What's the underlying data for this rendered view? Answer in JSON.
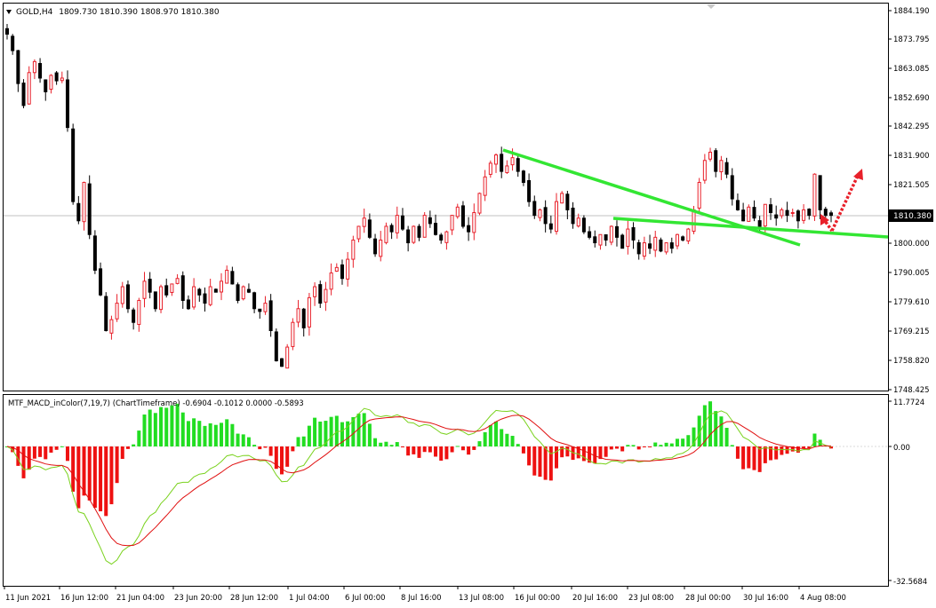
{
  "header": {
    "symbol": "GOLD,H4",
    "ohlc": "1809.730 1810.390 1808.970 1810.380"
  },
  "indicator": {
    "label": "MTF_MACD_inColor(7,19,7) (ChartTimeframe) -0.6904 -0.1012 0.0000 -0.5893"
  },
  "colors": {
    "bull_candle": "#e8202a",
    "bear_candle": "#000000",
    "trendline": "#33e633",
    "arrow": "#e8202a",
    "hist_pos": "#22dd22",
    "hist_neg": "#ee1111",
    "macd_line": "#7ad21e",
    "signal_line": "#e01010",
    "price_line": "#c0c0c0"
  },
  "chart_data": [
    {
      "type": "candlestick",
      "symbol": "GOLD",
      "timeframe": "H4",
      "y_ticks": [
        "1884.190",
        "1873.795",
        "1863.085",
        "1852.690",
        "1842.295",
        "1831.900",
        "1821.505",
        "1810.380",
        "1800.000",
        "1790.005",
        "1779.610",
        "1769.215",
        "1758.820",
        "1748.425"
      ],
      "current_price": "1810.380",
      "ylim": [
        1746.5,
        1886.5
      ],
      "x_ticks": [
        "11 Jun 2021",
        "16 Jun 12:00",
        "21 Jun 04:00",
        "23 Jun 20:00",
        "28 Jun 12:00",
        "1 Jul 04:00",
        "6 Jul 00:00",
        "8 Jul 16:00",
        "13 Jul 08:00",
        "16 Jul 00:00",
        "20 Jul 16:00",
        "23 Jul 08:00",
        "28 Jul 00:00",
        "30 Jul 16:00",
        "4 Aug 08:00"
      ],
      "close_path": [
        1876,
        1870,
        1858,
        1850,
        1862,
        1866,
        1860,
        1855,
        1861,
        1859,
        1860,
        1842,
        1815,
        1808,
        1822,
        1803,
        1790,
        1781,
        1768,
        1772,
        1778,
        1784,
        1776,
        1771,
        1779,
        1786,
        1782,
        1776,
        1784,
        1781,
        1785,
        1787,
        1779,
        1776,
        1784,
        1781,
        1778,
        1784,
        1782,
        1786,
        1790,
        1785,
        1779,
        1784,
        1782,
        1776,
        1775,
        1778,
        1768,
        1757,
        1755,
        1762,
        1771,
        1776,
        1769,
        1780,
        1784,
        1778,
        1783,
        1789,
        1791,
        1787,
        1794,
        1801,
        1806,
        1809,
        1802,
        1796,
        1801,
        1806,
        1804,
        1810,
        1805,
        1800,
        1806,
        1802,
        1810,
        1807,
        1803,
        1801,
        1804,
        1810,
        1813,
        1806,
        1804,
        1811,
        1818,
        1824,
        1829,
        1832,
        1826,
        1828,
        1831,
        1826,
        1822,
        1815,
        1810,
        1812,
        1807,
        1805,
        1815,
        1818,
        1812,
        1807,
        1809,
        1804,
        1802,
        1800,
        1803,
        1801,
        1806,
        1802,
        1798,
        1805,
        1801,
        1796,
        1800,
        1798,
        1802,
        1797,
        1800,
        1798,
        1803,
        1801,
        1805,
        1812,
        1822,
        1830,
        1833,
        1826,
        1830,
        1825,
        1816,
        1812,
        1808,
        1813,
        1809,
        1806,
        1814,
        1811,
        1809,
        1812,
        1810,
        1811,
        1808,
        1812,
        1810,
        1825,
        1812,
        1810,
        1810
      ]
    },
    {
      "type": "bar",
      "name": "MTF_MACD_inColor(7,19,7)",
      "y_ticks": [
        "11.7724",
        "0.00",
        "-32.5684"
      ],
      "ylim": [
        -32.5684,
        11.7724
      ],
      "values": {
        "histogram": -0.6904,
        "macd": -0.1012,
        "level": 0.0,
        "signal": -0.5893
      }
    }
  ]
}
